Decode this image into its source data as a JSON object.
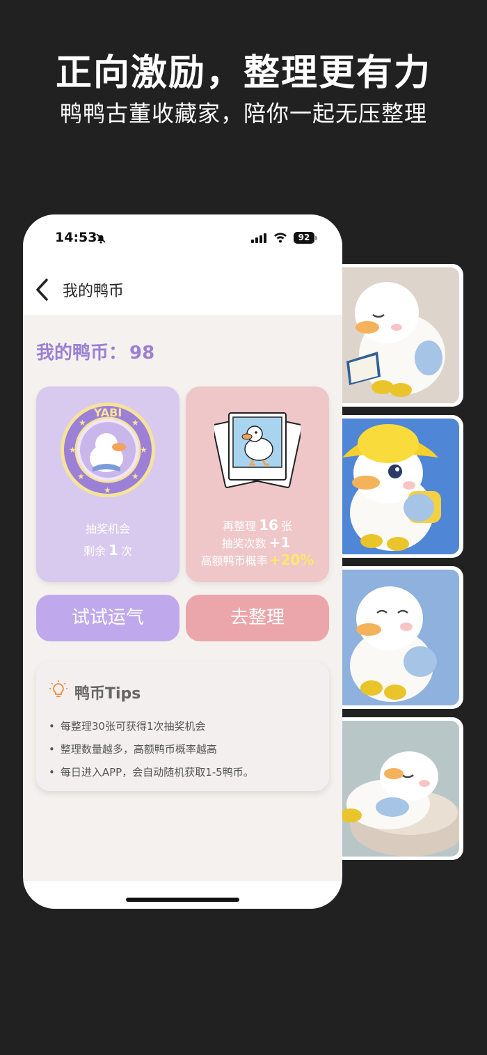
{
  "hero": {
    "title": "正向激励，整理更有力",
    "subtitle": "鸭鸭古董收藏家，陪你一起无压整理"
  },
  "status_bar": {
    "time": "14:53",
    "battery": "92"
  },
  "nav": {
    "title": "我的鸭币"
  },
  "coins": {
    "label": "我的鸭币：",
    "value": "98"
  },
  "lottery_card": {
    "badge_text": "YABI",
    "line1": "抽奖机会",
    "remaining_prefix": "剩余",
    "remaining_count": "1",
    "remaining_suffix": "次"
  },
  "organize_card": {
    "line1_prefix": "再整理",
    "line1_count": "16",
    "line1_suffix": "张",
    "line2_prefix": "抽奖次数",
    "line2_value": "+1",
    "line3_prefix": "高额鸭币概率",
    "line3_value": "+20%"
  },
  "buttons": {
    "try_luck": "试试运气",
    "go_organize": "去整理"
  },
  "tips": {
    "title": "鸭币Tips",
    "items": [
      "每整理30张可获得1次抽奖机会",
      "整理数量越多，高额鸭币概率越高",
      "每日进入APP，会自动随机获取1-5鸭币。"
    ]
  },
  "colors": {
    "background": "#212121",
    "accent_purple": "#9b7fd4",
    "lottery_card": "#d8caee",
    "organize_card": "#efc7c9",
    "try_button": "#bfa9ec",
    "organize_button": "#eaa6aa",
    "highlight_gold": "#ffe66a"
  },
  "icons": {
    "back": "chevron-left-icon",
    "tips": "lightbulb-icon",
    "bell": "bell-slash-icon"
  }
}
